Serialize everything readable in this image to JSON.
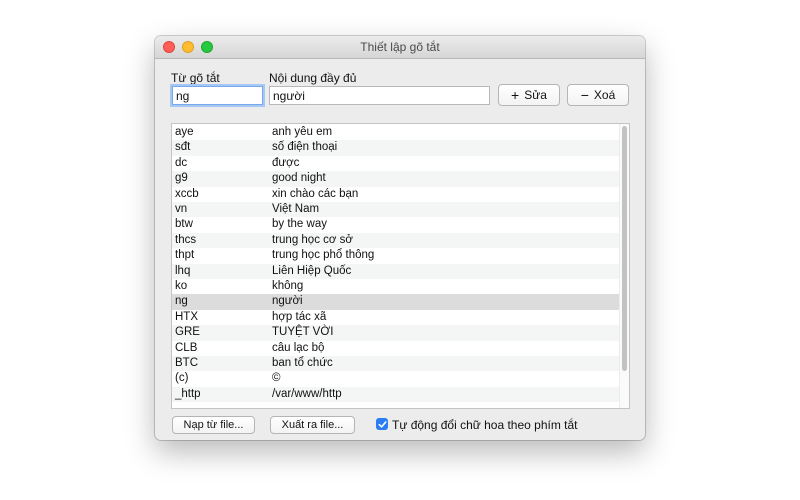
{
  "window": {
    "title": "Thiết lập gõ tắt"
  },
  "labels": {
    "shortcut": "Từ gõ tắt",
    "content": "Nội dung đầy đủ"
  },
  "inputs": {
    "shortcut_value": "ng",
    "content_value": "người"
  },
  "buttons": {
    "edit": {
      "icon": "plus-icon",
      "glyph": "+",
      "label": "Sửa"
    },
    "delete": {
      "icon": "minus-icon",
      "glyph": "−",
      "label": "Xoá"
    },
    "load": "Nạp từ file...",
    "export": "Xuất ra file..."
  },
  "list": {
    "selected_index": 11,
    "rows": [
      {
        "shortcut": "aye",
        "content": "anh yêu em"
      },
      {
        "shortcut": "sđt",
        "content": "số điện thoại"
      },
      {
        "shortcut": "dc",
        "content": "được"
      },
      {
        "shortcut": "g9",
        "content": "good night"
      },
      {
        "shortcut": "xccb",
        "content": "xin chào các bạn"
      },
      {
        "shortcut": "vn",
        "content": "Việt Nam"
      },
      {
        "shortcut": "btw",
        "content": "by the way"
      },
      {
        "shortcut": "thcs",
        "content": "trung học cơ sở"
      },
      {
        "shortcut": "thpt",
        "content": "trung học phổ thông"
      },
      {
        "shortcut": "lhq",
        "content": "Liên Hiệp Quốc"
      },
      {
        "shortcut": "ko",
        "content": "không"
      },
      {
        "shortcut": "ng",
        "content": "người"
      },
      {
        "shortcut": "HTX",
        "content": "hợp tác xã"
      },
      {
        "shortcut": "GRE",
        "content": "TUYỆT VỜI"
      },
      {
        "shortcut": "CLB",
        "content": "câu lạc bộ"
      },
      {
        "shortcut": "BTC",
        "content": "ban tổ chức"
      },
      {
        "shortcut": "(c)",
        "content": "©"
      },
      {
        "shortcut": "_http",
        "content": "/var/www/http"
      }
    ]
  },
  "options": {
    "auto_capitalize_label": "Tự động đổi chữ hoa theo phím tắt",
    "auto_capitalize_checked": true
  }
}
